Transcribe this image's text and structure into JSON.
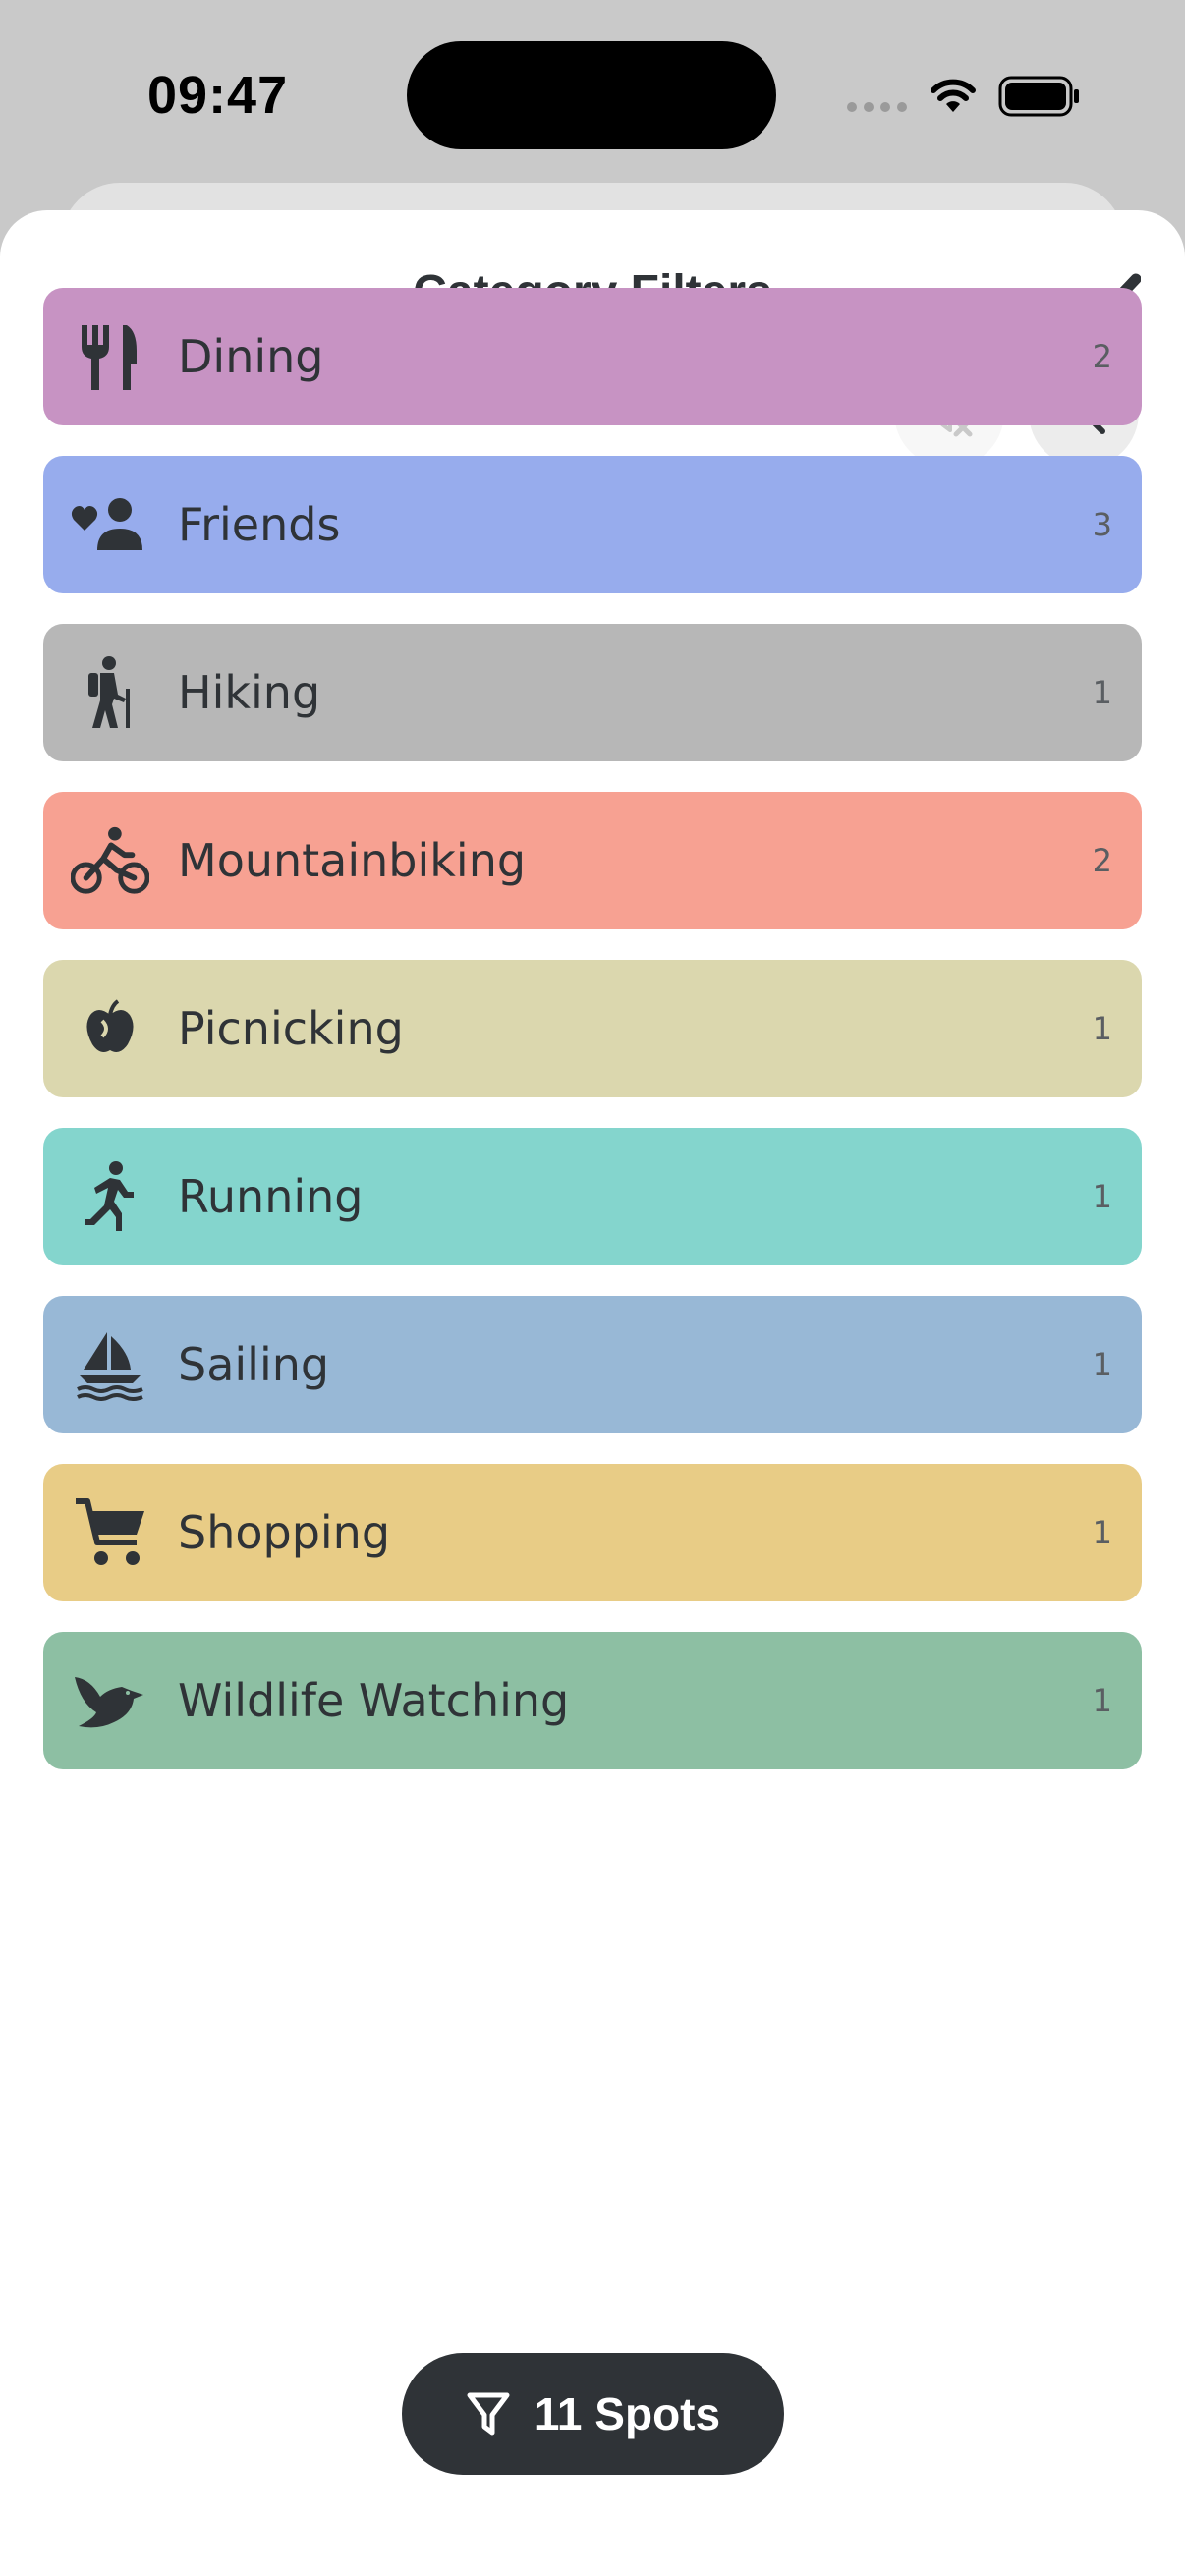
{
  "status": {
    "time": "09:47"
  },
  "sheet": {
    "title": "Category Filters",
    "done_icon": "checkmark-icon",
    "clear_icon": "filter-clear-icon",
    "search_icon": "search-icon"
  },
  "categories": [
    {
      "label": "Dining",
      "count": "2",
      "color": "#c793c3",
      "icon": "fork-knife-icon"
    },
    {
      "label": "Friends",
      "count": "3",
      "color": "#97aced",
      "icon": "heart-person-icon"
    },
    {
      "label": "Hiking",
      "count": "1",
      "color": "#b7b7b7",
      "icon": "hiker-icon"
    },
    {
      "label": "Mountainbiking",
      "count": "2",
      "color": "#f7a192",
      "icon": "bicycle-icon"
    },
    {
      "label": "Picnicking",
      "count": "1",
      "color": "#dbd7ae",
      "icon": "apple-icon"
    },
    {
      "label": "Running",
      "count": "1",
      "color": "#84d5cd",
      "icon": "runner-icon"
    },
    {
      "label": "Sailing",
      "count": "1",
      "color": "#98b8d6",
      "icon": "sailboat-icon"
    },
    {
      "label": "Shopping",
      "count": "1",
      "color": "#e8cc86",
      "icon": "cart-icon"
    },
    {
      "label": "Wildlife Watching",
      "count": "1",
      "color": "#8dbfa3",
      "icon": "bird-icon"
    }
  ],
  "footer": {
    "spots_label": "11 Spots",
    "spots_icon": "filter-icon"
  }
}
